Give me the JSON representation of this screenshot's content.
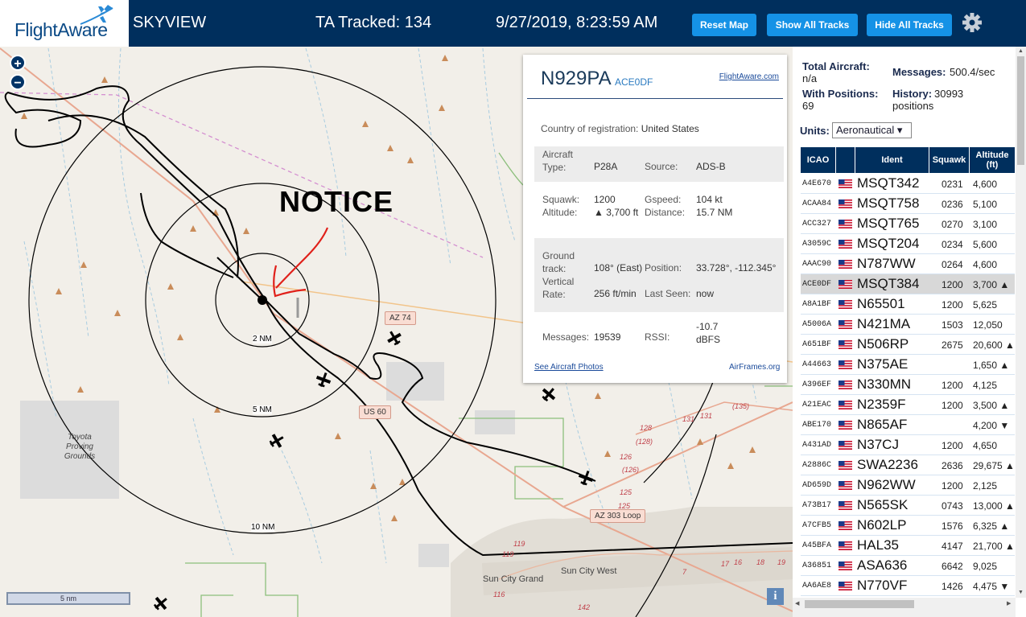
{
  "header": {
    "logo_text": "FlightAware",
    "title": "SKYVIEW",
    "tracked": "TA Tracked: 134",
    "datetime": "9/27/2019, 8:23:59 AM",
    "buttons": [
      "Reset Map",
      "Show All Tracks",
      "Hide All Tracks"
    ]
  },
  "map": {
    "notice": "NOTICE",
    "range_labels": [
      "2 NM",
      "5 NM",
      "10 NM"
    ],
    "road_badges": [
      "AZ 74",
      "US 60",
      "AZ 303 Loop"
    ],
    "place_labels": [
      "Toyota Proving Grounds",
      "Sun City Grand",
      "Sun City West"
    ],
    "route_numbers": [
      "131",
      "131",
      "(135)",
      "128",
      "(128)",
      "(126)",
      "126",
      "125",
      "125",
      "119",
      "119",
      "116",
      "142",
      "17",
      "16",
      "18",
      "19",
      "7"
    ],
    "scale": "5 nm",
    "info_icon": "i"
  },
  "popup": {
    "registration": "N929PA",
    "hex": "ACE0DF",
    "link": "FlightAware.com",
    "country_label": "Country of registration:",
    "country": "United States",
    "aircraft_type_label": "Aircraft Type:",
    "aircraft_type": "P28A",
    "source_label": "Source:",
    "source": "ADS-B",
    "squawk_label": "Squawk:",
    "squawk": "1200",
    "gspeed_label": "Gspeed:",
    "gspeed": "104 kt",
    "altitude_label": "Altitude:",
    "altitude": "▲ 3,700 ft",
    "distance_label": "Distance:",
    "distance": "15.7 NM",
    "ground_track_label": "Ground track:",
    "ground_track": "108° (East)",
    "position_label": "Position:",
    "position": "33.728°, -112.345°",
    "vrate_label": "Vertical Rate:",
    "vrate": "256 ft/min",
    "last_seen_label": "Last Seen:",
    "last_seen": "now",
    "messages_label": "Messages:",
    "messages": "19539",
    "rssi_label": "RSSI:",
    "rssi": "-10.7 dBFS",
    "photos_link": "See Aircraft Photos",
    "airframes_link": "AirFrames.org"
  },
  "sidebar": {
    "total_aircraft_label": "Total Aircraft:",
    "total_aircraft": "n/a",
    "messages_label": "Messages:",
    "messages": "500.4/sec",
    "with_positions_label": "With Positions:",
    "with_positions": "69",
    "history_label": "History:",
    "history": "30993 positions",
    "units_label": "Units:",
    "units": "Aeronautical ▾",
    "columns": [
      "ICAO",
      "",
      "Ident",
      "Squawk",
      "Altitude (ft)"
    ],
    "rows": [
      {
        "icao": "A4E670",
        "ident": "MSQT342",
        "squawk": "0231",
        "alt": "4,600"
      },
      {
        "icao": "ACAA84",
        "ident": "MSQT758",
        "squawk": "0236",
        "alt": "5,100"
      },
      {
        "icao": "ACC327",
        "ident": "MSQT765",
        "squawk": "0270",
        "alt": "3,100"
      },
      {
        "icao": "A3059C",
        "ident": "MSQT204",
        "squawk": "0234",
        "alt": "5,600"
      },
      {
        "icao": "AAAC90",
        "ident": "N787WW",
        "squawk": "0264",
        "alt": "4,600"
      },
      {
        "icao": "ACE0DF",
        "ident": "MSQT384",
        "squawk": "1200",
        "alt": "3,700 ▲"
      },
      {
        "icao": "A8A1BF",
        "ident": "N65501",
        "squawk": "1200",
        "alt": "5,625"
      },
      {
        "icao": "A5006A",
        "ident": "N421MA",
        "squawk": "1503",
        "alt": "12,050"
      },
      {
        "icao": "A651BF",
        "ident": "N506RP",
        "squawk": "2675",
        "alt": "20,600 ▲"
      },
      {
        "icao": "A44663",
        "ident": "N375AE",
        "squawk": "",
        "alt": "1,650 ▲"
      },
      {
        "icao": "A396EF",
        "ident": "N330MN",
        "squawk": "1200",
        "alt": "4,125"
      },
      {
        "icao": "A21EAC",
        "ident": "N2359F",
        "squawk": "1200",
        "alt": "3,500 ▲"
      },
      {
        "icao": "ABE170",
        "ident": "N865AF",
        "squawk": "",
        "alt": "4,200 ▼"
      },
      {
        "icao": "A431AD",
        "ident": "N37CJ",
        "squawk": "1200",
        "alt": "4,650"
      },
      {
        "icao": "A2886C",
        "ident": "SWA2236",
        "squawk": "2636",
        "alt": "29,675 ▲"
      },
      {
        "icao": "AD659D",
        "ident": "N962WW",
        "squawk": "1200",
        "alt": "2,125"
      },
      {
        "icao": "A73B17",
        "ident": "N565SK",
        "squawk": "0743",
        "alt": "13,000 ▲"
      },
      {
        "icao": "A7CFB5",
        "ident": "N602LP",
        "squawk": "1576",
        "alt": "6,325 ▲"
      },
      {
        "icao": "A45BFA",
        "ident": "HAL35",
        "squawk": "4147",
        "alt": "21,700 ▲"
      },
      {
        "icao": "A36851",
        "ident": "ASA636",
        "squawk": "6642",
        "alt": "9,025"
      },
      {
        "icao": "AA6AE8",
        "ident": "N770VF",
        "squawk": "1426",
        "alt": "4,475 ▼"
      }
    ],
    "selected_index": 5
  },
  "colors": {
    "header_bg": "#002f5d",
    "button_bg": "#1592e6",
    "map_bg": "#f2efe9"
  }
}
